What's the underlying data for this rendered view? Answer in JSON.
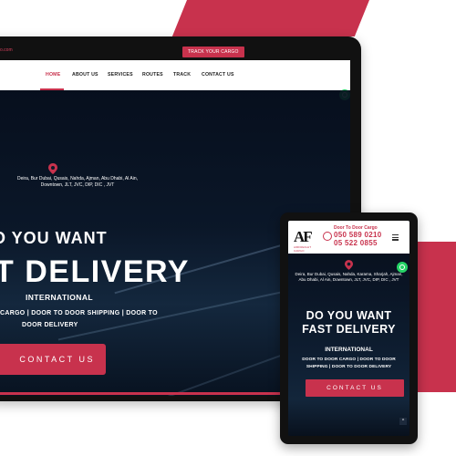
{
  "colors": {
    "accent": "#c8324d",
    "whatsapp": "#25d366",
    "hero_dark": "#0d1a2a"
  },
  "laptop": {
    "topbar": {
      "email": "o.com",
      "track_button": "TRACK YOUR CARGO"
    },
    "nav": [
      {
        "label": "HOME",
        "active": true
      },
      {
        "label": "ABOUT US"
      },
      {
        "label": "SERVICES"
      },
      {
        "label": "ROUTES"
      },
      {
        "label": "TRACK"
      },
      {
        "label": "CONTACT US"
      }
    ],
    "hero": {
      "areas": "Deira, Bur Dubai, Qusais, Nahda, Ajman, Abu Dhabi, Al Ain, Downtown, JLT, JVC, DIP, DIC , JVT",
      "heading_line1": "O YOU WANT",
      "heading_line2": "T DELIVERY",
      "subheading": "INTERNATIONAL",
      "services_line1": "CARGO | DOOR TO DOOR SHIPPING | DOOR TO",
      "services_line2": "DOOR DELIVERY",
      "contact_button": "CONTACT US"
    },
    "icons": {
      "whatsapp": "whatsapp-icon",
      "location": "location-pin-icon"
    }
  },
  "tablet": {
    "header": {
      "logo_mark": "AF",
      "logo_tagline": "AIRFREIGHT CARGO",
      "door_label": "Door To Door Cargo",
      "phone1": "050 589 0210",
      "phone2": "05 522 0855"
    },
    "hero": {
      "areas": "Deira, Bur Dubai, Qusais, Nahda, Karama, Sharjah, Ajman, Abu Dhabi, Al Ain, Downtown, JLT, JVC, DIP, DIC , JVT",
      "heading_line1": "DO YOU WANT",
      "heading_line2": "FAST DELIVERY",
      "subheading": "INTERNATIONAL",
      "services_line1": "DOOR TO DOOR CARGO | DOOR TO DOOR",
      "services_line2": "SHIPPING | DOOR TO DOOR DELIVERY",
      "contact_button": "CONTACT US",
      "scroll_up": "^"
    },
    "icons": {
      "menu": "hamburger-menu-icon",
      "phone": "phone-icon",
      "whatsapp": "whatsapp-icon",
      "location": "location-pin-icon"
    }
  }
}
